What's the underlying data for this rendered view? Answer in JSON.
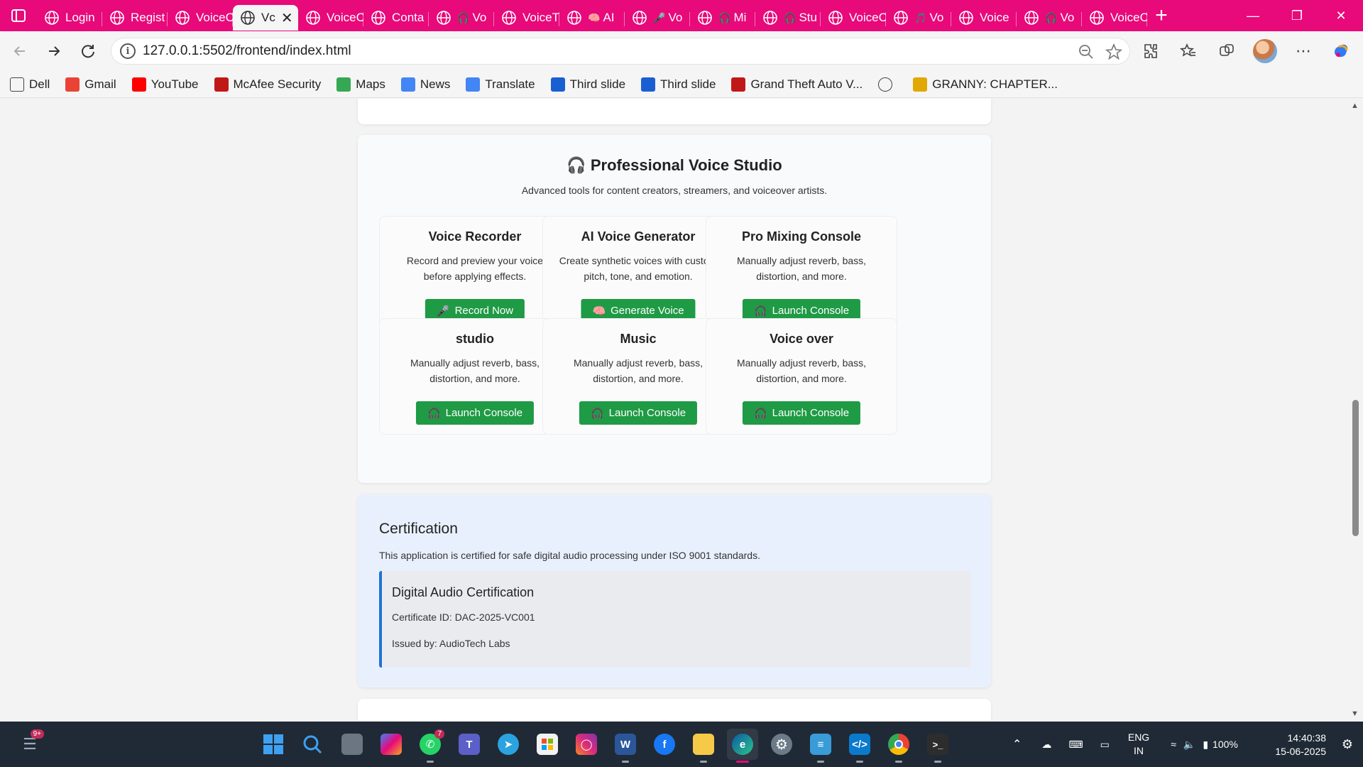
{
  "tabs": [
    {
      "label": "Login",
      "emoji": ""
    },
    {
      "label": "Regist",
      "emoji": ""
    },
    {
      "label": "VoiceC",
      "emoji": ""
    },
    {
      "label": "Vc",
      "emoji": "",
      "active": true
    },
    {
      "label": "VoiceC",
      "emoji": ""
    },
    {
      "label": "Conta",
      "emoji": ""
    },
    {
      "label": "Vo",
      "emoji": "🎧"
    },
    {
      "label": "VoiceT",
      "emoji": ""
    },
    {
      "label": "AI",
      "emoji": "🧠"
    },
    {
      "label": "Vo",
      "emoji": "🎤"
    },
    {
      "label": "Mi",
      "emoji": "🎧"
    },
    {
      "label": "Stu",
      "emoji": "🎧"
    },
    {
      "label": "VoiceC",
      "emoji": ""
    },
    {
      "label": "Vo",
      "emoji": "🎵"
    },
    {
      "label": "Voice",
      "emoji": ""
    },
    {
      "label": "Vo",
      "emoji": "🎧"
    },
    {
      "label": "VoiceC",
      "emoji": ""
    }
  ],
  "address": {
    "url": "127.0.0.1:5502/frontend/index.html"
  },
  "bookmarks": [
    {
      "label": "Dell",
      "icon": "folder-icon",
      "color": "#444444"
    },
    {
      "label": "Gmail",
      "icon": "gmail-icon",
      "color": "#ea4335"
    },
    {
      "label": "YouTube",
      "icon": "youtube-icon",
      "color": "#ff0000"
    },
    {
      "label": "McAfee Security",
      "icon": "mcafee-icon",
      "color": "#c01818"
    },
    {
      "label": "Maps",
      "icon": "maps-icon",
      "color": "#34a853"
    },
    {
      "label": "News",
      "icon": "news-icon",
      "color": "#4285f4"
    },
    {
      "label": "Translate",
      "icon": "translate-icon",
      "color": "#4285f4"
    },
    {
      "label": "Third slide",
      "icon": "slide-icon",
      "color": "#1a5fd1"
    },
    {
      "label": "Third slide",
      "icon": "slide-icon",
      "color": "#1a5fd1"
    },
    {
      "label": "Grand Theft Auto V...",
      "icon": "car-icon",
      "color": "#c01818"
    },
    {
      "label": "",
      "icon": "globe-icon",
      "color": "#444444"
    },
    {
      "label": "GRANNY: CHAPTER...",
      "icon": "crown-icon",
      "color": "#e0a800"
    }
  ],
  "studio": {
    "title": "Professional Voice Studio",
    "title_icon": "🎧",
    "subtitle": "Advanced tools for content creators, streamers, and voiceover artists.",
    "tools": [
      {
        "title": "Voice Recorder",
        "desc": "Record and preview your voice before applying effects.",
        "button": "Record Now",
        "button_icon": "🎤"
      },
      {
        "title": "AI Voice Generator",
        "desc": "Create synthetic voices with custom pitch, tone, and emotion.",
        "button": "Generate Voice",
        "button_icon": "🧠"
      },
      {
        "title": "Pro Mixing Console",
        "desc": "Manually adjust reverb, bass, distortion, and more.",
        "button": "Launch Console",
        "button_icon": "🎧"
      },
      {
        "title": "studio",
        "desc": "Manually adjust reverb, bass, distortion, and more.",
        "button": "Launch Console",
        "button_icon": "🎧"
      },
      {
        "title": "Music",
        "desc": "Manually adjust reverb, bass, distortion, and more.",
        "button": "Launch Console",
        "button_icon": "🎧"
      },
      {
        "title": "Voice over",
        "desc": "Manually adjust reverb, bass, distortion, and more.",
        "button": "Launch Console",
        "button_icon": "🎧"
      }
    ]
  },
  "certification": {
    "title": "Certification",
    "description": "This application is certified for safe digital audio processing under ISO 9001 standards.",
    "box_title": "Digital Audio Certification",
    "certificate_id": "Certificate ID: DAC-2025-VC001",
    "issued_by": "Issued by: AudioTech Labs"
  },
  "taskbar": {
    "widgets_badge": "9+",
    "whatsapp_badge": "7",
    "lang_line1": "ENG",
    "lang_line2": "IN",
    "battery": "100%",
    "time": "14:40:38",
    "date": "15-06-2025"
  },
  "colors": {
    "accent": "#e8097a",
    "button_green": "#1f9a45",
    "cert_border": "#2272d8"
  }
}
